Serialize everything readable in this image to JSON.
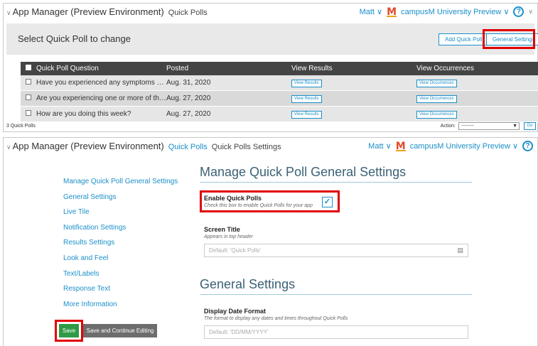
{
  "top": {
    "app_title": "App Manager (Preview Environment)",
    "crumb": "Quick Polls",
    "user": "Matt",
    "tenant": "campusM University Preview",
    "page_title": "Select Quick Poll to change",
    "add_btn": "Add Quick Poll",
    "settings_btn": "General Settings",
    "columns": [
      "Quick Poll Question",
      "Posted",
      "View Results",
      "View Occurrences"
    ],
    "rows": [
      {
        "question": "Have you experienced any symptoms of ...",
        "posted": "Aug. 31, 2020",
        "results": "View Results",
        "occurrences": "View Occurrences"
      },
      {
        "question": "Are you experiencing one or more of the ...",
        "posted": "Aug. 27, 2020",
        "results": "View Results",
        "occurrences": "View Occurrences"
      },
      {
        "question": "How are you doing this week?",
        "posted": "Aug. 27, 2020",
        "results": "View Results",
        "occurrences": "View Occurrences"
      }
    ],
    "count": "3 Quick Polls",
    "action_label": "Action:",
    "action_value": "---------",
    "go": "Go"
  },
  "bottom": {
    "app_title": "App Manager (Preview Environment)",
    "crumb_link": "Quick Polls",
    "crumb_current": "Quick Polls Settings",
    "user": "Matt",
    "tenant": "campusM University Preview",
    "nav": [
      "Manage Quick Poll General Settings",
      "General Settings",
      "Live Tile",
      "Notification Settings",
      "Results Settings",
      "Look and Feel",
      "Text/Labels",
      "Response Text",
      "More Information"
    ],
    "section1": "Manage Quick Poll General Settings",
    "enable_label": "Enable Quick Polls",
    "enable_help": "Check this box to enable Quick Polls for your app",
    "screen_title_label": "Screen Title",
    "screen_title_help": "Appears in top header",
    "screen_title_placeholder": "Default: 'Quick Polls'",
    "section2": "General Settings",
    "date_label": "Display Date Format",
    "date_help": "The format to display any dates and times throughout Quick Polls",
    "date_placeholder": "Default: 'DD/MM/YYYY'",
    "save": "Save",
    "save_continue": "Save and Continue Editing"
  },
  "colors": {
    "accent": "#1a8fc9",
    "highlight": "#e10000",
    "save": "#2e9a45",
    "header": "#444444"
  }
}
